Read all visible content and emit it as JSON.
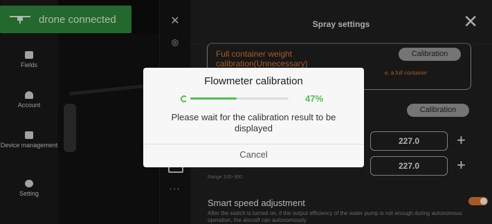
{
  "status": {
    "connection_label": "drone connected",
    "accent": "#2f8b3c"
  },
  "nav": {
    "items": [
      {
        "label": "Fields",
        "icon": "fields-icon"
      },
      {
        "label": "Account",
        "icon": "account-icon"
      },
      {
        "label": "Device management",
        "icon": "device-icon"
      },
      {
        "label": "Setting",
        "icon": "setting-icon"
      }
    ]
  },
  "tools": {
    "more_label": "..."
  },
  "panel": {
    "title": "Spray settings",
    "full_weight": {
      "title": "Full container weight calibration(Unnecessary)",
      "hint": "e, a full container",
      "button": "Calibration"
    },
    "flow_button": "Calibration",
    "field1_value": "227.0",
    "field2_value": "227.0",
    "range_text": "Range 100~300",
    "smart_title": "Smart speed adjustment",
    "smart_desc": "After the switch is turned on, if the output efficiency of the water pump is not enough during autonomous operation, the aircraft can autonomously",
    "smart_on": true
  },
  "modal": {
    "title": "Flowmeter calibration",
    "progress": 0.47,
    "progress_label": "47%",
    "message": "Please wait for the calibration result to be displayed",
    "cancel_label": "Cancel",
    "accent": "#45c34d"
  }
}
